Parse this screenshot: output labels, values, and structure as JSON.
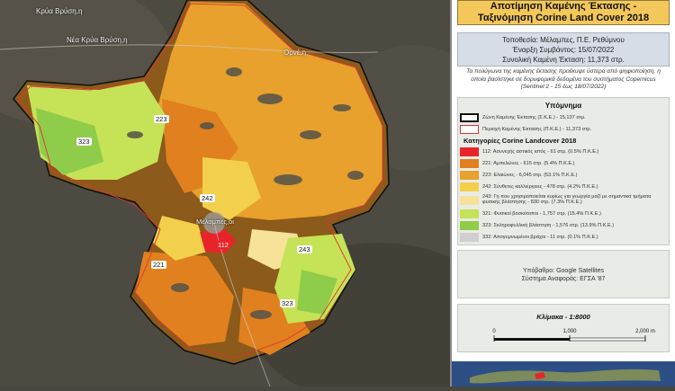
{
  "title_lines": [
    "Αποτίμηση Καμένης Έκτασης -",
    "Ταξινόμηση Corine Land Cover 2018"
  ],
  "info": {
    "location": "Τοποθεσία: Μέλαμπες, Π.Ε. Ρεθύμνου",
    "start": "Έναρξη Συμβάντος: 15/07/2022",
    "area": "Συνολική Καμένη Έκταση: 11,373 στρ."
  },
  "note": "Τα πολύγωνα της καμένης έκτασης προέκυψε ύστερα από ψηφιοποίηση, η οποία βασίστηκε σε δορυφορικά δεδομένα του συστήματος Copernicus (Sentinel 2 - 15 έως 18/07/2022)",
  "legend": {
    "title": "Υπόμνημα",
    "zone_label": "Ζώνη Καμένης Έκτασης (Σ.Κ.Ε.) - 15,137 στρ.",
    "area_label": "Περιοχή Καμένης Έκτασης (Π.Κ.Ε.) - 11,373 στρ.",
    "categories_title": "Κατηγορίες Corine Landcover 2018",
    "classes": [
      {
        "label": "112: Ασυνεχής αστικός ιστός - 61 στρ. (0.5% Π.Κ.Ε.)",
        "color": "#e8242a"
      },
      {
        "label": "221: Αμπελώνες - 615 στρ. (5.4% Π.Κ.Ε.)",
        "color": "#e0801e"
      },
      {
        "label": "223: Ελαιώνες - 6,045 στρ. (53.1% Π.Κ.Ε.)",
        "color": "#e7a12c"
      },
      {
        "label": "242: Σύνθετες καλλιέργειες - 478 στρ. (4.2% Π.Κ.Ε.)",
        "color": "#f2d04c"
      },
      {
        "label": "243: Γη που χρησιμοποιείται κυρίως για γεωργία μαζί με σημαντικά τμήματα φυσικής βλάστησης - 830 στρ. (7.3% Π.Κ.Ε.)",
        "color": "#f6e298"
      },
      {
        "label": "321: Φυσικοί βοσκότοποι - 1,757 στρ. (15.4% Π.Κ.Ε.)",
        "color": "#c6e256"
      },
      {
        "label": "323: Σκληροφυλλική βλάστηση - 1,576 στρ. (13.9% Π.Κ.Ε.)",
        "color": "#8fcc4a"
      },
      {
        "label": "332: Απογυμνωμένοι βράχοι - 11 στρ. (0.1% Π.Κ.Ε.)",
        "color": "#cfcfcf"
      }
    ]
  },
  "source": {
    "basemap": "Υπόβαθρο: Google Satellites",
    "crs": "Σύστημα Αναφοράς: ΕΓΣΑ '87"
  },
  "scale": {
    "title": "Κλίμακα - 1:8000",
    "ticks": [
      "0",
      "1,000",
      "2,000 m"
    ]
  },
  "map": {
    "places": [
      "Κρύα Βρύση,η",
      "Νέα Κρύα Βρύση,η",
      "Ορνέ,η",
      "Μέλαμπες,οι"
    ],
    "codes": [
      "323",
      "223",
      "242",
      "112",
      "221",
      "243",
      "323"
    ]
  }
}
